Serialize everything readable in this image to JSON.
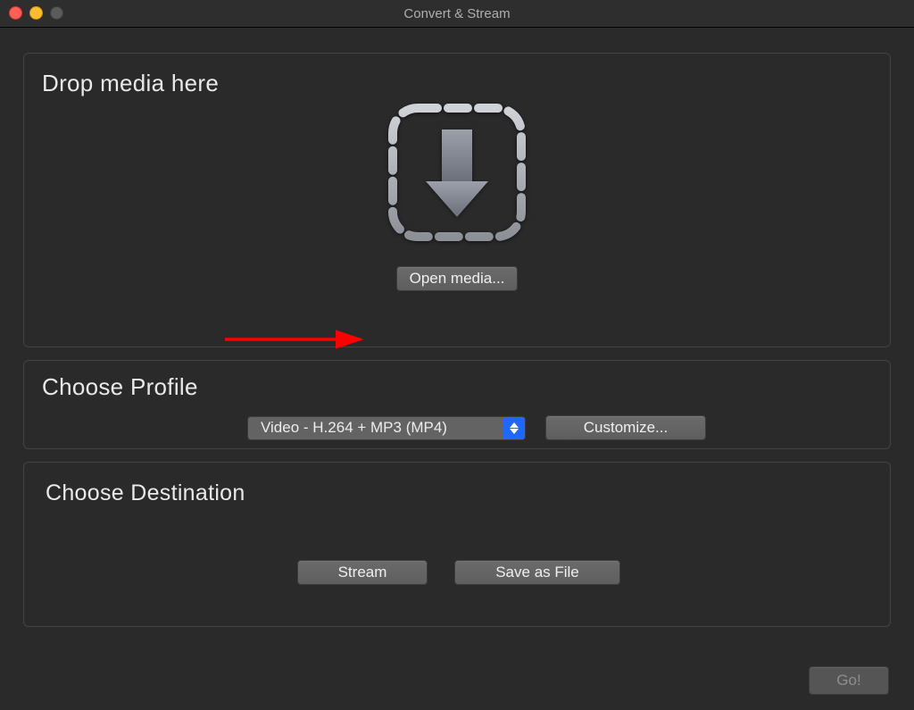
{
  "window": {
    "title": "Convert & Stream"
  },
  "drop": {
    "heading": "Drop media here",
    "open_button": "Open media..."
  },
  "profile": {
    "heading": "Choose Profile",
    "selected": "Video - H.264 + MP3 (MP4)",
    "customize_button": "Customize..."
  },
  "destination": {
    "heading": "Choose Destination",
    "stream_button": "Stream",
    "save_button": "Save as File"
  },
  "footer": {
    "go_button": "Go!"
  },
  "colors": {
    "accent_blue": "#1f68ff",
    "annotation_red": "#ff0000"
  }
}
